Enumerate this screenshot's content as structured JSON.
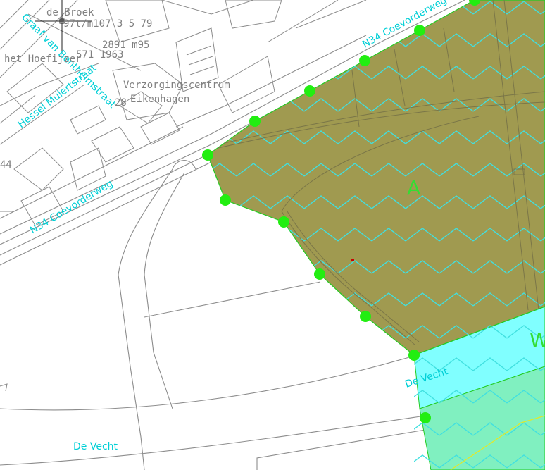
{
  "map": {
    "street_labels": {
      "n34_top": "N34  Coevorderweg",
      "n34_bottom": "N34  Coevorderweg",
      "de_vecht_river": "De  Vecht",
      "de_vecht_bottom": "De  Vecht",
      "hessel_mulertstraat": "Hessel  Mulertstraat",
      "graaf_van_bentheimstraat": "Graaf van Bentheimstraat"
    },
    "building_labels": {
      "verzorgingscentrum": "Verzorgingscentrum",
      "eikenhagen": "Eikenhagen",
      "het_hoefijzer": "het  Hoefijzer",
      "num_28": "28",
      "num_44": "44",
      "num_2891": "2891 m95",
      "num_5711963": "571 1963",
      "num_971": "97t/m107 3 5 79",
      "top_code": "de  Broek"
    },
    "zones": {
      "zone_a": {
        "label": "A",
        "fill": "#a09a50"
      },
      "zone_w": {
        "label": "W",
        "fill": "#80ffff"
      },
      "zone_green": {
        "label": "",
        "fill": "#80f0c0"
      }
    },
    "colors": {
      "vertex_marker": "#22ee11",
      "zigzag": "#40e0e0",
      "base_lines": "#8c8c8c"
    },
    "vertex_marker_icon": "green-dot-icon"
  }
}
